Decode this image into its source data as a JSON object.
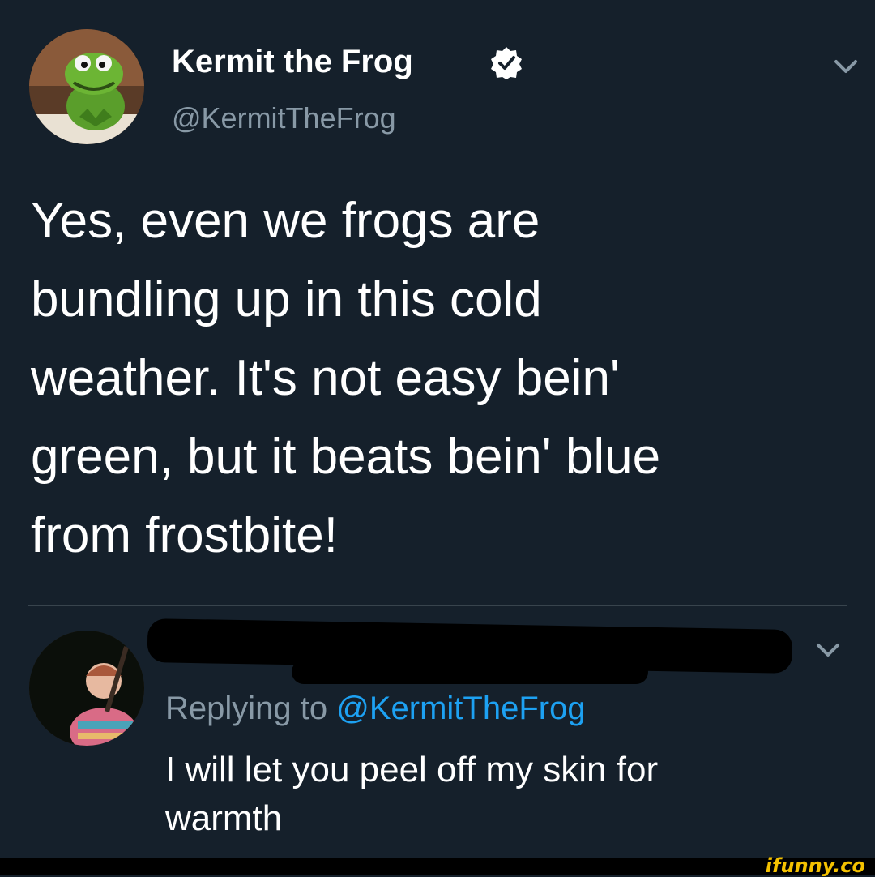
{
  "tweet": {
    "author_name": "Kermit the Frog",
    "author_handle": "@KermitTheFrog",
    "verified_icon": "verified-badge-icon",
    "menu_icon": "chevron-down-icon",
    "text": "Yes, even we frogs are\nbundling up in this cold\nweather. It's not easy bein'\ngreen, but it beats bein' blue\nfrom frostbite!"
  },
  "reply": {
    "replying_prefix": "Replying to ",
    "replying_mention": "@KermitTheFrog",
    "text": "I will let you peel off my skin for\nwarmth",
    "menu_icon": "chevron-down-icon"
  },
  "watermark": "ifunny.co",
  "colors": {
    "background": "#15202b",
    "secondary_text": "#8899a6",
    "link": "#1da1f2",
    "divider": "#38444d",
    "verified": "#ffffff"
  }
}
